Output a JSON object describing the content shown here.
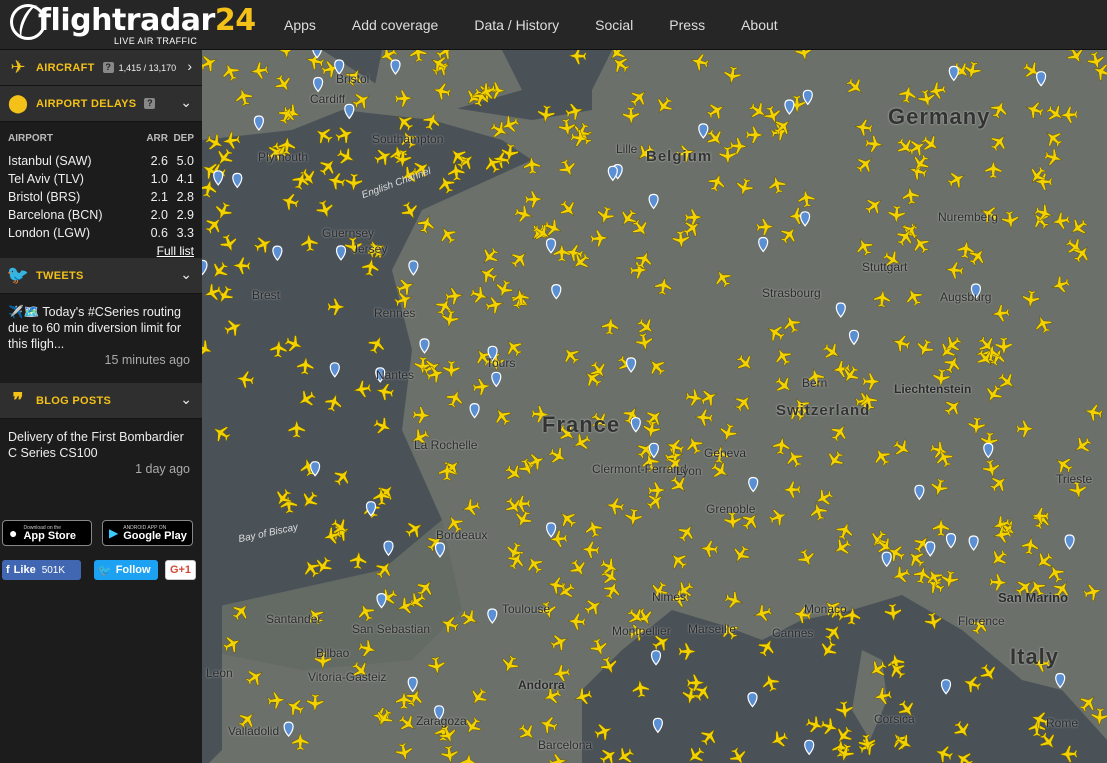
{
  "header": {
    "brand_text": "flightradar",
    "brand_num": "24",
    "tagline": "LIVE AIR TRAFFIC",
    "nav": [
      "Apps",
      "Add coverage",
      "Data / History",
      "Social",
      "Press",
      "About"
    ]
  },
  "sidebar": {
    "aircraft": {
      "title": "AIRCRAFT",
      "count": "1,415 / 13,170",
      "help": "?"
    },
    "delays": {
      "title": "AIRPORT DELAYS",
      "help": "?",
      "col_airport": "AIRPORT",
      "col_arr": "ARR",
      "col_dep": "DEP",
      "rows": [
        {
          "name": "Istanbul (SAW)",
          "arr": "2.6",
          "dep": "5.0"
        },
        {
          "name": "Tel Aviv (TLV)",
          "arr": "1.0",
          "dep": "4.1"
        },
        {
          "name": "Bristol (BRS)",
          "arr": "2.1",
          "dep": "2.8"
        },
        {
          "name": "Barcelona (BCN)",
          "arr": "2.0",
          "dep": "2.9"
        },
        {
          "name": "London (LGW)",
          "arr": "0.6",
          "dep": "3.3"
        }
      ],
      "full_list": "Full list"
    },
    "tweets": {
      "title": "TWEETS",
      "text": "✈️🗺️ Today's #CSeries routing due to 60 min diversion limit for this fligh...",
      "ago": "15 minutes ago"
    },
    "blog": {
      "title": "BLOG POSTS",
      "text": "Delivery of the First Bombardier C Series CS100",
      "ago": "1 day ago"
    },
    "stores": {
      "apple_small": "Download on the",
      "apple_big": "App Store",
      "google_small": "ANDROID APP ON",
      "google_big": "Google Play"
    },
    "social": {
      "fb_like": "Like",
      "fb_count": "501K",
      "tw_follow": "Follow",
      "gplus": "G+1"
    }
  },
  "map": {
    "countries": [
      "Germany",
      "France",
      "Switzerland",
      "Italy",
      "Belgium"
    ],
    "cities": [
      "Bristol",
      "Cardiff",
      "Southampton",
      "Plymouth",
      "Guernsey",
      "Jersey",
      "Brest",
      "Rennes",
      "Nantes",
      "Tours",
      "La Rochelle",
      "Bordeaux",
      "Clermont-Ferrand",
      "Lyon",
      "Grenoble",
      "Nimes",
      "Montpellier",
      "Marseille",
      "Toulouse",
      "Andorra",
      "Barcelona",
      "Zaragoza",
      "Bilbao",
      "Santander",
      "San Sebastian",
      "Vitoria-Gasteiz",
      "Valladolid",
      "Leon",
      "Strasbourg",
      "Stuttgart",
      "Augsburg",
      "Nuremberg",
      "Lille",
      "Liechtenstein",
      "Trieste",
      "San Marino",
      "Florence",
      "Rome",
      "Corsica",
      "Cannes",
      "Monaco",
      "Geneva",
      "Bern"
    ],
    "seas": [
      "English Channel",
      "Bay of Biscay"
    ],
    "colors": {
      "land": "#6b706a",
      "sea": "#4a5258",
      "plane": "#f3d200",
      "pin": "#5b8fd4"
    }
  }
}
